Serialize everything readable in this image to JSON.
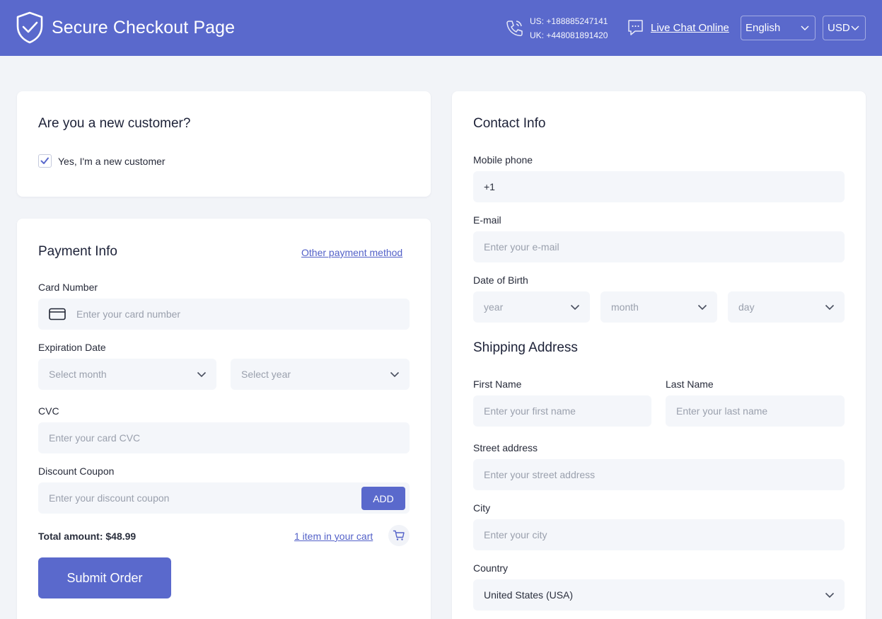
{
  "header": {
    "title": "Secure Checkout Page",
    "phone_us": "US: +188885247141",
    "phone_uk": "UK: +448081891420",
    "chat_label": "Live Chat Online",
    "language": "English",
    "currency": "USD"
  },
  "new_customer": {
    "heading": "Are you a new customer?",
    "checkbox_label": "Yes, I'm a new customer",
    "checked": true
  },
  "payment": {
    "heading": "Payment Info",
    "other_method_link": "Other payment method",
    "card_number_label": "Card Number",
    "card_number_placeholder": "Enter your card number",
    "expiration_label": "Expiration Date",
    "month_placeholder": "Select month",
    "year_placeholder": "Select year",
    "cvc_label": "CVC",
    "cvc_placeholder": "Enter your card CVC",
    "coupon_label": "Discount Coupon",
    "coupon_placeholder": "Enter your discount coupon",
    "add_button": "ADD",
    "total": "Total amount: $48.99",
    "cart_link": "1 item in your cart",
    "submit_button": "Submit Order"
  },
  "contact": {
    "heading": "Contact Info",
    "mobile_label": "Mobile phone",
    "mobile_value": "+1",
    "email_label": "E-mail",
    "email_placeholder": "Enter your e-mail",
    "dob_label": "Date of Birth",
    "dob_year": "year",
    "dob_month": "month",
    "dob_day": "day"
  },
  "shipping": {
    "heading": "Shipping Address",
    "first_name_label": "First Name",
    "first_name_placeholder": "Enter your first name",
    "last_name_label": "Last Name",
    "last_name_placeholder": "Enter your last name",
    "street_label": "Street address",
    "street_placeholder": "Enter your street address",
    "city_label": "City",
    "city_placeholder": "Enter your city",
    "country_label": "Country",
    "country_value": "United States (USA)"
  },
  "colors": {
    "brand": "#5a69cc",
    "background": "#f2f4f8",
    "field_bg": "#f4f6fa",
    "link": "#5361c8"
  },
  "icons": [
    "shield-check-icon",
    "phone-icon",
    "chat-bubble-icon",
    "chevron-down-icon",
    "credit-card-icon",
    "checkmark-icon",
    "cart-icon"
  ]
}
